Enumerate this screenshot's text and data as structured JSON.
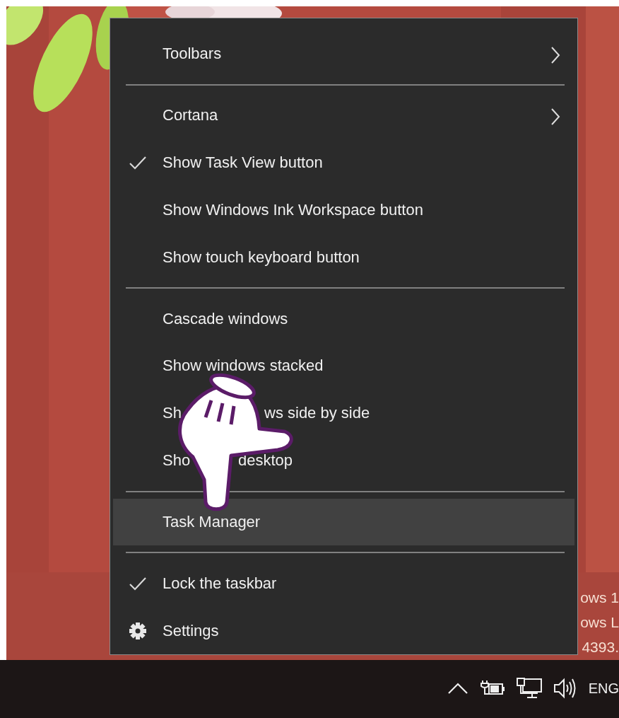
{
  "menu": {
    "items": [
      {
        "kind": "item",
        "label": "Toolbars",
        "checked": false,
        "submenu": true,
        "selected": false
      },
      {
        "kind": "divider"
      },
      {
        "kind": "item",
        "label": "Cortana",
        "checked": false,
        "submenu": true,
        "selected": false
      },
      {
        "kind": "item",
        "label": "Show Task View button",
        "checked": true,
        "submenu": false,
        "selected": false
      },
      {
        "kind": "item",
        "label": "Show Windows Ink Workspace button",
        "checked": false,
        "submenu": false,
        "selected": false
      },
      {
        "kind": "item",
        "label": "Show touch keyboard button",
        "checked": false,
        "submenu": false,
        "selected": false
      },
      {
        "kind": "divider"
      },
      {
        "kind": "item",
        "label": "Cascade windows",
        "checked": false,
        "submenu": false,
        "selected": false
      },
      {
        "kind": "item",
        "label": "Show windows stacked",
        "checked": false,
        "submenu": false,
        "selected": false
      },
      {
        "kind": "item",
        "label_fragments": [
          "Sh",
          "ws side by side"
        ],
        "checked": false,
        "submenu": false,
        "selected": false
      },
      {
        "kind": "item",
        "label_fragments": [
          "Sho",
          "desktop"
        ],
        "checked": false,
        "submenu": false,
        "selected": false
      },
      {
        "kind": "divider"
      },
      {
        "kind": "item",
        "label": "Task Manager",
        "checked": false,
        "submenu": false,
        "selected": true
      },
      {
        "kind": "divider"
      },
      {
        "kind": "item",
        "label": "Lock the taskbar",
        "checked": true,
        "submenu": false,
        "selected": false
      },
      {
        "kind": "settings",
        "label": "Settings",
        "checked": false,
        "submenu": false,
        "selected": false
      }
    ]
  },
  "desktop": {
    "text_lines": [
      "ows 1",
      "ows L",
      "4393."
    ]
  },
  "taskbar": {
    "language": "ENG"
  }
}
